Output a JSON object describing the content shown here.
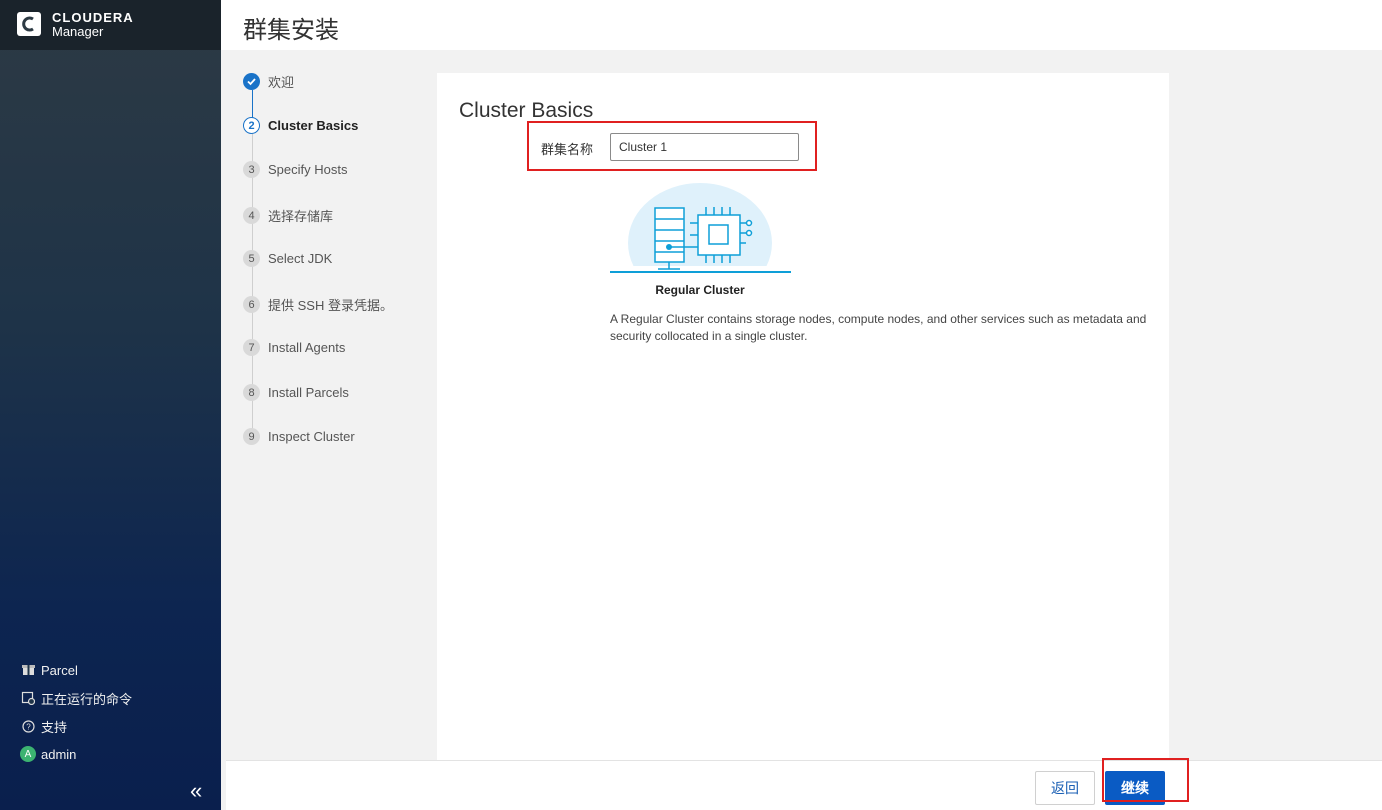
{
  "brand": {
    "name": "CLOUDERA",
    "product": "Manager"
  },
  "header": {
    "title": "群集安装"
  },
  "steps": [
    {
      "num": "✓",
      "label": "欢迎",
      "state": "done"
    },
    {
      "num": "2",
      "label": "Cluster Basics",
      "state": "current"
    },
    {
      "num": "3",
      "label": "Specify Hosts",
      "state": "pending"
    },
    {
      "num": "4",
      "label": "选择存储库",
      "state": "pending"
    },
    {
      "num": "5",
      "label": "Select JDK",
      "state": "pending"
    },
    {
      "num": "6",
      "label": "提供 SSH 登录凭据。",
      "state": "pending"
    },
    {
      "num": "7",
      "label": "Install Agents",
      "state": "pending"
    },
    {
      "num": "8",
      "label": "Install Parcels",
      "state": "pending"
    },
    {
      "num": "9",
      "label": "Inspect Cluster",
      "state": "pending"
    }
  ],
  "main": {
    "title": "Cluster Basics",
    "name_label": "群集名称",
    "name_value": "Cluster 1",
    "cluster_type": {
      "title": "Regular Cluster",
      "description": "A Regular Cluster contains storage nodes, compute nodes, and other services such as metadata and security collocated in a single cluster."
    }
  },
  "sidebar": {
    "items": [
      {
        "icon": "parcel-icon",
        "label": "Parcel"
      },
      {
        "icon": "running-commands-icon",
        "label": "正在运行的命令"
      },
      {
        "icon": "help-icon",
        "label": "支持"
      },
      {
        "icon": "user-avatar",
        "label": "admin",
        "avatar_letter": "A"
      }
    ],
    "collapse_glyph": "«"
  },
  "footer": {
    "back_label": "返回",
    "continue_label": "继续"
  },
  "colors": {
    "accent": "#0a5bc4",
    "highlight": "#e02020",
    "sidebar_top": "#2d3a44",
    "sidebar_bottom": "#0a1f4d"
  }
}
